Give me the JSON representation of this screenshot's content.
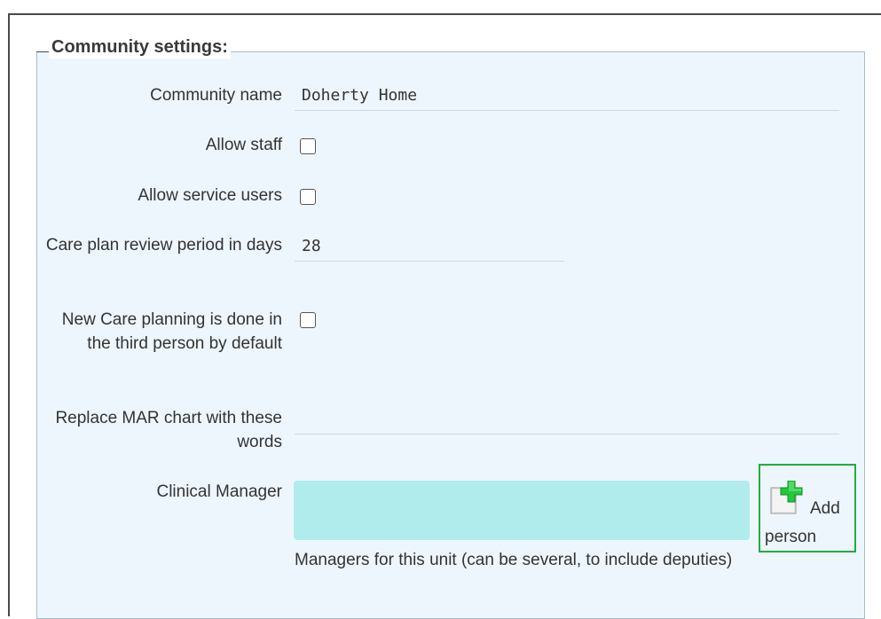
{
  "section": {
    "legend": "Community settings:"
  },
  "fields": {
    "community_name": {
      "label": "Community name",
      "value": "Doherty Home"
    },
    "allow_staff": {
      "label": "Allow staff",
      "checked": false
    },
    "allow_service_users": {
      "label": "Allow service users",
      "checked": false
    },
    "care_plan_review": {
      "label": "Care plan review period in days",
      "value": "28"
    },
    "third_person": {
      "label": "New Care planning is done in the third person by default",
      "checked": false
    },
    "replace_mar": {
      "label": "Replace MAR chart with these words",
      "value": ""
    },
    "clinical_manager": {
      "label": "Clinical Manager",
      "add_line1": "Add",
      "add_line2": "person",
      "help": "Managers for this unit (can be several, to include deputies)"
    }
  },
  "colors": {
    "panel_bg": "#eef6fd",
    "person_box": "#b1ecec",
    "add_border": "#1fae3e",
    "plus_green": "#22c93a"
  },
  "icons": {
    "add_person": "plus-icon"
  }
}
